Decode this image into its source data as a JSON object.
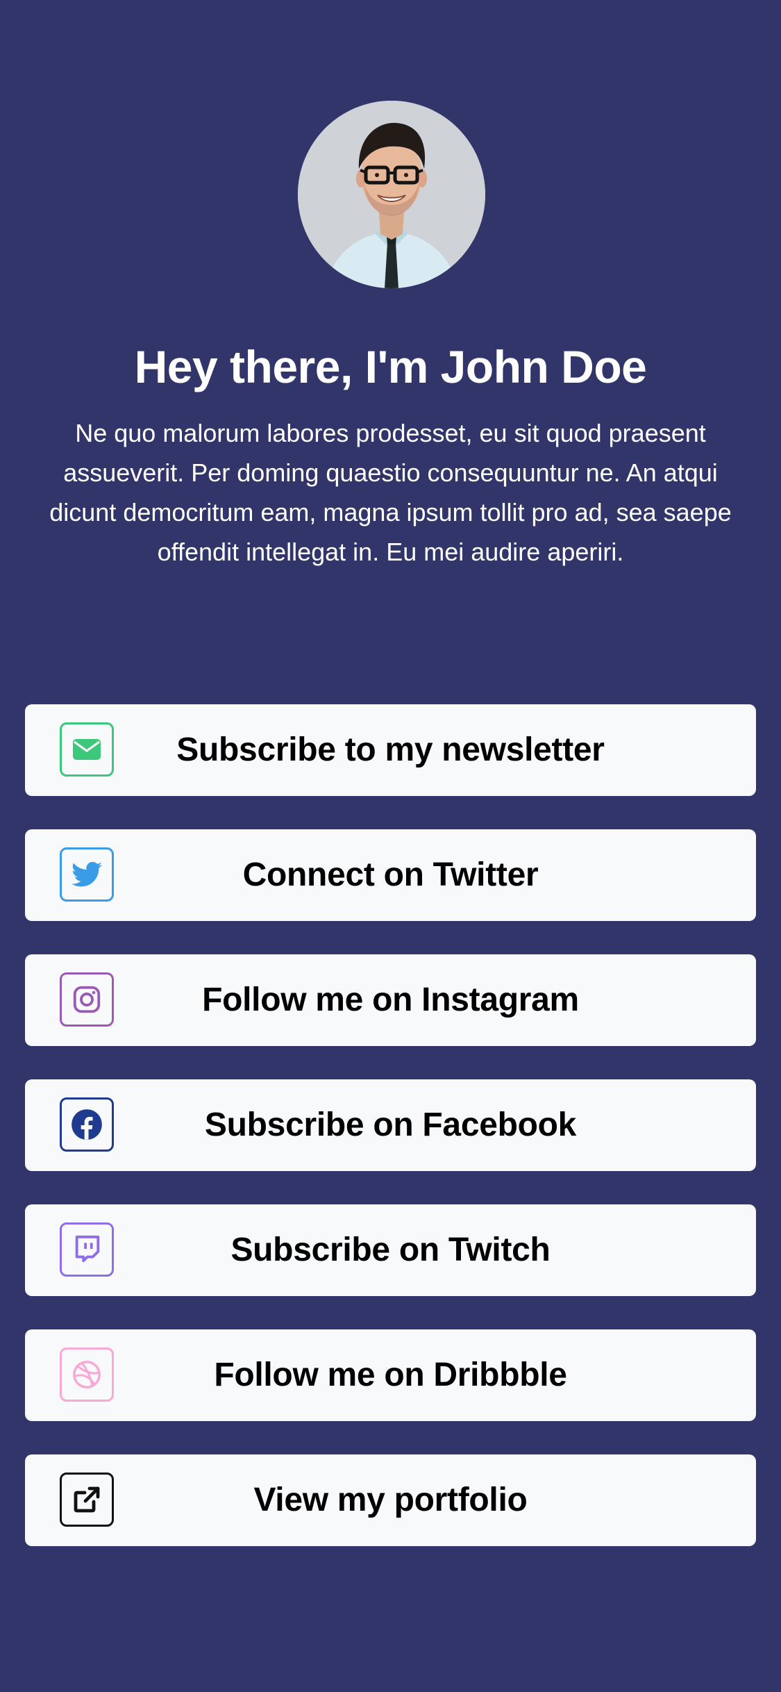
{
  "profile": {
    "avatar_icon": "person-photo",
    "headline": "Hey there, I'm John Doe",
    "bio": "Ne quo malorum labores prodesset, eu sit quod praesent assueverit. Per doming quaestio consequuntur ne. An atqui dicunt democritum eam, magna ipsum tollit pro ad, sea saepe offendit intellegat in. Eu mei audire aperiri."
  },
  "colors": {
    "background": "#32356a",
    "card": "#f8f9fb"
  },
  "links": [
    {
      "label": "Subscribe to my newsletter",
      "icon": "mail-icon",
      "color": "#3cc87a"
    },
    {
      "label": "Connect on Twitter",
      "icon": "twitter-icon",
      "color": "#3a9be6"
    },
    {
      "label": "Follow me on Instagram",
      "icon": "instagram-icon",
      "color": "#9b59b6"
    },
    {
      "label": "Subscribe on Facebook",
      "icon": "facebook-icon",
      "color": "#1e3b8f"
    },
    {
      "label": "Subscribe on Twitch",
      "icon": "twitch-icon",
      "color": "#8d6ee8"
    },
    {
      "label": "Follow me on Dribbble",
      "icon": "dribbble-icon",
      "color": "#f7a8d4"
    },
    {
      "label": "View my portfolio",
      "icon": "external-link-icon",
      "color": "#111111"
    }
  ]
}
